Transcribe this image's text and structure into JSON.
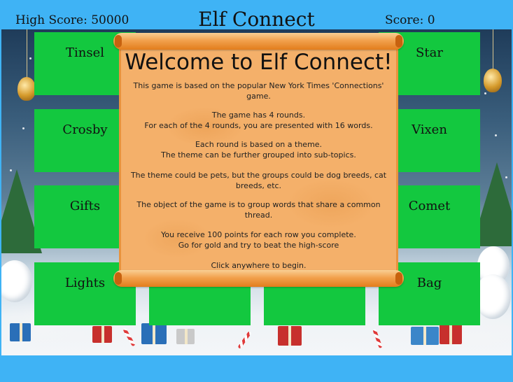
{
  "header": {
    "high_score": "High Score: 50000",
    "title": "Elf Connect",
    "score": "Score: 0"
  },
  "tiles": {
    "r1c1": "Tinsel",
    "r1c4": "Star",
    "r2c1": "Crosby",
    "r2c4": "Vixen",
    "r3c1": "Gifts",
    "r3c4": "Comet",
    "r4c1": "Lights",
    "r4c4": "Bag"
  },
  "modal": {
    "title": "Welcome to Elf Connect!",
    "p1": "This game is based on the popular New York Times 'Connections' game.",
    "p2a": "The game has 4 rounds.",
    "p2b": "For each of the 4 rounds, you are presented with 16 words.",
    "p3a": "Each round is based on a theme.",
    "p3b": "The theme can be further grouped into sub-topics.",
    "p4": "The theme could be pets, but the groups could be dog breeds, cat breeds, etc.",
    "p5": "The object of the game is to group words that share a common thread.",
    "p6a": "You receive 100 points for each row you complete.",
    "p6b": "Go for gold and try to beat the high-score",
    "click_hint": "Click anywhere to begin."
  },
  "colors": {
    "bar_blue": "#3fb3f5",
    "tile_green": "#13c83f",
    "scroll_orange": "#f4b06a"
  }
}
